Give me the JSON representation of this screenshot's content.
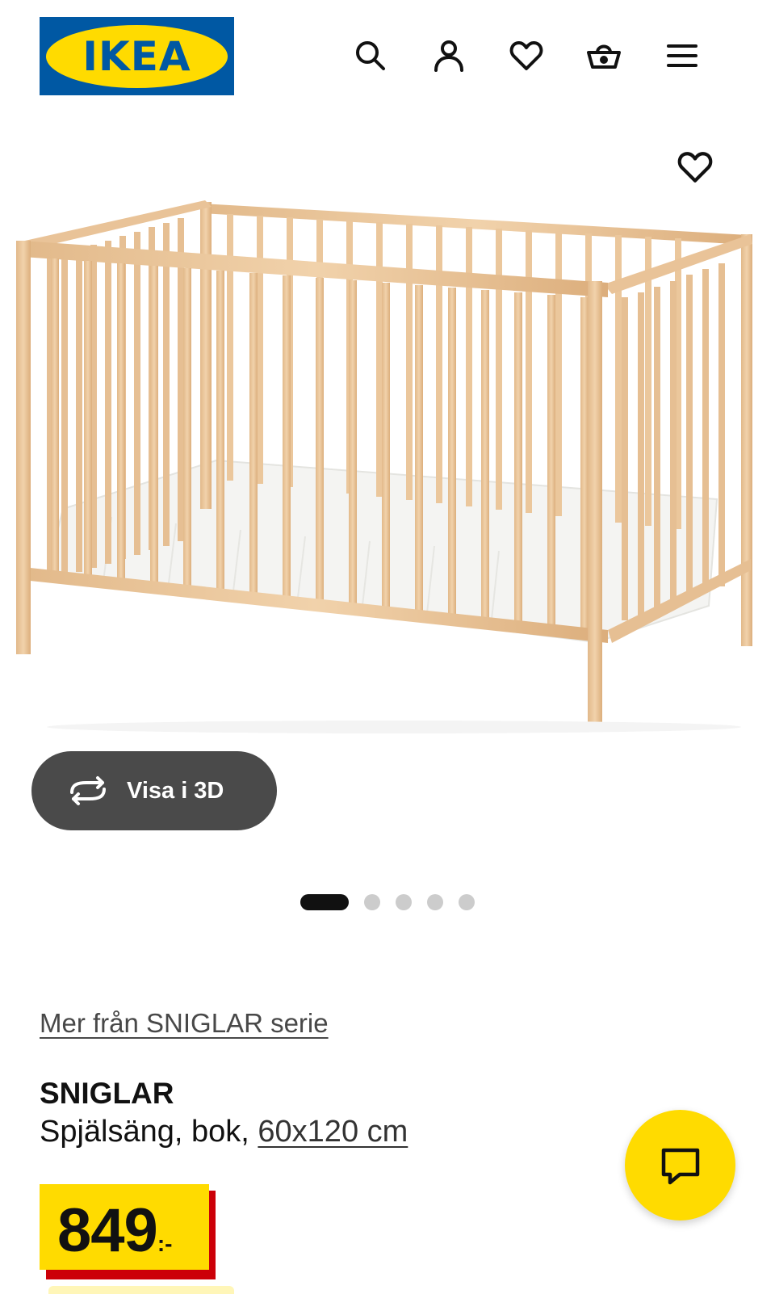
{
  "header": {
    "logo_text": "IKEA",
    "logo_reg": "®",
    "icons": [
      "search-icon",
      "user-icon",
      "heart-icon",
      "cart-icon",
      "menu-icon"
    ]
  },
  "gallery": {
    "favorite_icon": "heart-icon",
    "view_3d_label": "Visa i 3D",
    "view_3d_icon": "rotate-icon",
    "slide_count": 5,
    "active_slide": 1
  },
  "product": {
    "series_link": "Mer från SNIGLAR serie",
    "name": "SNIGLAR",
    "description": "Spjälsäng, bok,",
    "size": "60x120 cm",
    "price_integer": "849",
    "price_suffix": ":-"
  },
  "chat": {
    "icon": "chat-icon"
  },
  "colors": {
    "brand_blue": "#0058a3",
    "brand_yellow": "#ffdb00",
    "price_red": "#cc0008",
    "button_dark": "#4a4a4a"
  }
}
